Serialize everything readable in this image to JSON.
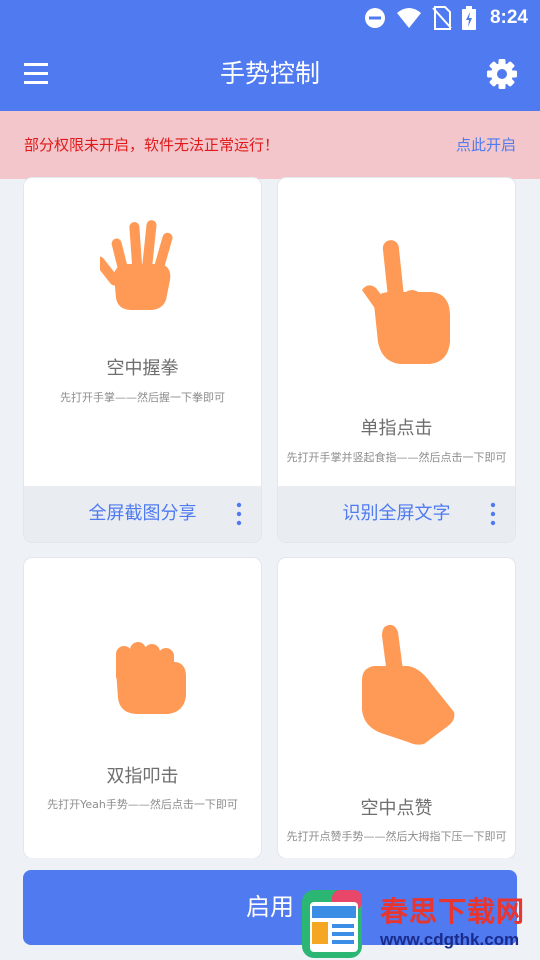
{
  "status_bar": {
    "time": "8:24",
    "icons": [
      "do-not-disturb-icon",
      "wifi-icon",
      "no-sim-icon",
      "battery-charging-icon"
    ]
  },
  "app_bar": {
    "title": "手势控制",
    "menu_icon": "menu-icon",
    "settings_icon": "gear-icon"
  },
  "warning": {
    "text": "部分权限未开启，软件无法正常运行！",
    "link": "点此开启"
  },
  "cards": [
    {
      "gesture_icon": "open-hand-icon",
      "title": "空中握拳",
      "description": "先打开手掌——然后握一下拳即可",
      "action": "全屏截图分享",
      "more_icon": "more-vert-icon"
    },
    {
      "gesture_icon": "pointing-finger-icon",
      "title": "单指点击",
      "description": "先打开手掌并竖起食指——然后点击一下即可",
      "action": "识别全屏文字",
      "more_icon": "more-vert-icon"
    },
    {
      "gesture_icon": "fist-icon",
      "title": "双指叩击",
      "description": "先打开Yeah手势——然后点击一下即可"
    },
    {
      "gesture_icon": "thumbs-up-icon",
      "title": "空中点赞",
      "description": "先打开点赞手势——然后大拇指下压一下即可"
    }
  ],
  "enable_button": {
    "label": "启用"
  },
  "watermark": {
    "brand": "春思下载网",
    "url": "www.cdgthk.com"
  },
  "colors": {
    "primary": "#4f7af0",
    "warning_bg": "#f2c6cb",
    "warning_text": "#e01a1a",
    "hand": "#ff9a56",
    "page_bg": "#eef1f5"
  }
}
